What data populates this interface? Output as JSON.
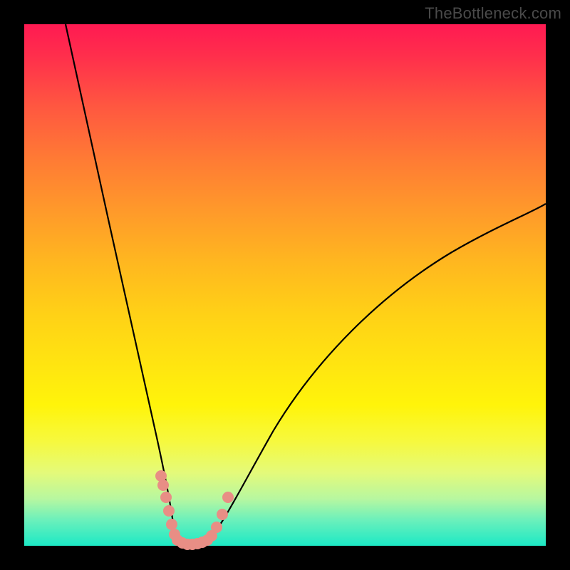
{
  "watermark": "TheBottleneck.com",
  "colors": {
    "frame_bg": "#000000",
    "dot": "#e88e85",
    "curve": "#000000"
  },
  "chart_data": {
    "type": "line",
    "title": "",
    "xlabel": "",
    "ylabel": "",
    "xlim": [
      0,
      100
    ],
    "ylim": [
      0,
      100
    ],
    "series": [
      {
        "name": "left-branch",
        "x": [
          8,
          10,
          12,
          14,
          16,
          18,
          20,
          22,
          24,
          25,
          26,
          27,
          27.5,
          28,
          28.3
        ],
        "y": [
          100,
          92,
          84,
          75,
          66,
          56,
          46,
          36,
          24,
          18,
          12,
          7,
          4,
          2,
          1
        ]
      },
      {
        "name": "valley-floor",
        "x": [
          28.3,
          29,
          30,
          31,
          32,
          33,
          33.7
        ],
        "y": [
          1,
          0.5,
          0.3,
          0.3,
          0.4,
          0.6,
          1
        ]
      },
      {
        "name": "right-branch",
        "x": [
          33.7,
          35,
          37,
          40,
          44,
          50,
          58,
          68,
          80,
          94,
          100
        ],
        "y": [
          1,
          3,
          7,
          13,
          20,
          29,
          38,
          47,
          55,
          62,
          66
        ]
      }
    ],
    "markers": [
      {
        "series": "left-markers",
        "x": [
          26.0,
          26.3,
          26.8,
          27.3,
          27.8,
          28.3,
          28.8
        ],
        "y": [
          13.5,
          12.0,
          9.5,
          6.5,
          3.8,
          2.0,
          1.2
        ]
      },
      {
        "series": "floor-markers",
        "x": [
          29.4,
          30.2,
          31.0,
          31.9,
          32.8,
          33.7
        ],
        "y": [
          0.6,
          0.4,
          0.35,
          0.45,
          0.65,
          1.0
        ]
      },
      {
        "series": "right-markers",
        "x": [
          34.3,
          35.1,
          36.0,
          36.9
        ],
        "y": [
          2.0,
          4.0,
          7.0,
          10.5
        ]
      }
    ]
  }
}
